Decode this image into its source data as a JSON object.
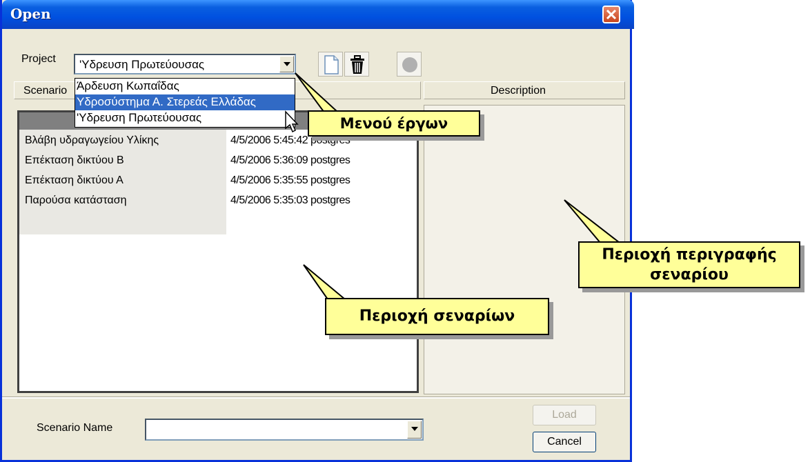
{
  "window": {
    "title": "Open"
  },
  "project": {
    "label": "Project",
    "selected": "'Υδρευση Πρωτεύουσας",
    "options": [
      "Άρδευση Κωπαΐδας",
      "Υδροσύστημα Α. Στερεάς Ελλάδας",
      "'Υδρευση Πρωτεύουσας"
    ],
    "highlighted_index": 1
  },
  "toolbar": {
    "new_icon": "new-document-icon",
    "delete_icon": "trash-icon",
    "record_icon": "circle-icon"
  },
  "tabs": {
    "scenarios": "Scenario",
    "description": "Description"
  },
  "scenarios": [
    {
      "name": "Βλάβη υδραγωγείου Υλίκης",
      "date": "4/5/2006 5:4",
      "date_tail": "5:42 postgres"
    },
    {
      "name": "Επέκταση δικτύου Β",
      "date": "4/5/2006 5:36:09 postgres"
    },
    {
      "name": "Επέκταση δικτύου Α",
      "date": "4/5/2006 5:35:55 postgres"
    },
    {
      "name": "Παρούσα κατάσταση",
      "date": "4/5/2006 5:35:03 postgres"
    }
  ],
  "callouts": {
    "menu": "Μενού έργων",
    "scenarios_area": "Περιοχή σεναρίων",
    "description_area_line1": "Περιοχή περιγραφής",
    "description_area_line2": "σεναρίου"
  },
  "footer": {
    "scenario_name_label": "Scenario Name",
    "scenario_name_value": "",
    "load_label": "Load",
    "cancel_label": "Cancel"
  },
  "colors": {
    "title_bar": "#0a5fe0",
    "callout_fill": "#ffff99",
    "selection": "#316ac5"
  }
}
